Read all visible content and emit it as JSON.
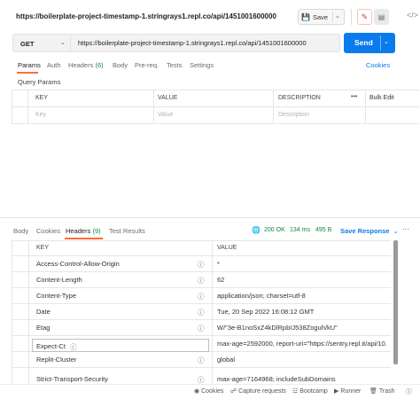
{
  "request": {
    "title": "https://boilerplate-project-timestamp-1.stringrays1.repl.co/api/1451001600000",
    "save_label": "Save",
    "method": "GET",
    "url": "https://boilerplate-project-timestamp-1.stringrays1.repl.co/api/1451001600000",
    "send_label": "Send"
  },
  "request_tabs": [
    {
      "label": "Params",
      "active": true
    },
    {
      "label": "Auth"
    },
    {
      "label": "Headers",
      "count": "(6)"
    },
    {
      "label": "Body"
    },
    {
      "label": "Pre-req."
    },
    {
      "label": "Tests"
    },
    {
      "label": "Settings"
    }
  ],
  "cookies_link": "Cookies",
  "query_params": {
    "title": "Query Params",
    "columns": [
      "KEY",
      "VALUE",
      "DESCRIPTION"
    ],
    "bulk_edit": "Bulk Edit",
    "more": "•••",
    "key_placeholder": "Key",
    "value_placeholder": "Value",
    "description_placeholder": "Description"
  },
  "response_tabs": [
    {
      "label": "Body"
    },
    {
      "label": "Cookies"
    },
    {
      "label": "Headers",
      "count": "(9)",
      "active": true
    },
    {
      "label": "Test Results"
    }
  ],
  "response_meta": {
    "status": "200 OK",
    "time": "134 ms",
    "size": "495 B",
    "save_response": "Save Response"
  },
  "response_headers": {
    "columns": [
      "KEY",
      "VALUE"
    ],
    "rows": [
      {
        "key": "Access-Control-Allow-Origin",
        "value": "*"
      },
      {
        "key": "Content-Length",
        "value": "62"
      },
      {
        "key": "Content-Type",
        "value": "application/json; charset=utf-8"
      },
      {
        "key": "Date",
        "value": "Tue, 20 Sep 2022 16:08:12 GMT"
      },
      {
        "key": "Etag",
        "value": "W/\"3e-B1noSxZ4kDlRpbIJ538Zoguh/kU\""
      },
      {
        "key": "Expect-Ct",
        "value": "max-age=2592000, report-uri=\"https://sentry.repl.it/api/10..."
      },
      {
        "key": "Replit-Cluster",
        "value": "global"
      },
      {
        "key": "Strict-Transport-Security",
        "value": "max-age=7164968; includeSubDomains"
      }
    ]
  },
  "footer": {
    "cookies": "Cookies",
    "capture": "Capture requests",
    "bootcamp": "Bootcamp",
    "runner": "Runner",
    "trash": "Trash"
  },
  "colors": {
    "accent": "#ff6c37",
    "send": "#097bed",
    "success": "#0f8a3c"
  }
}
